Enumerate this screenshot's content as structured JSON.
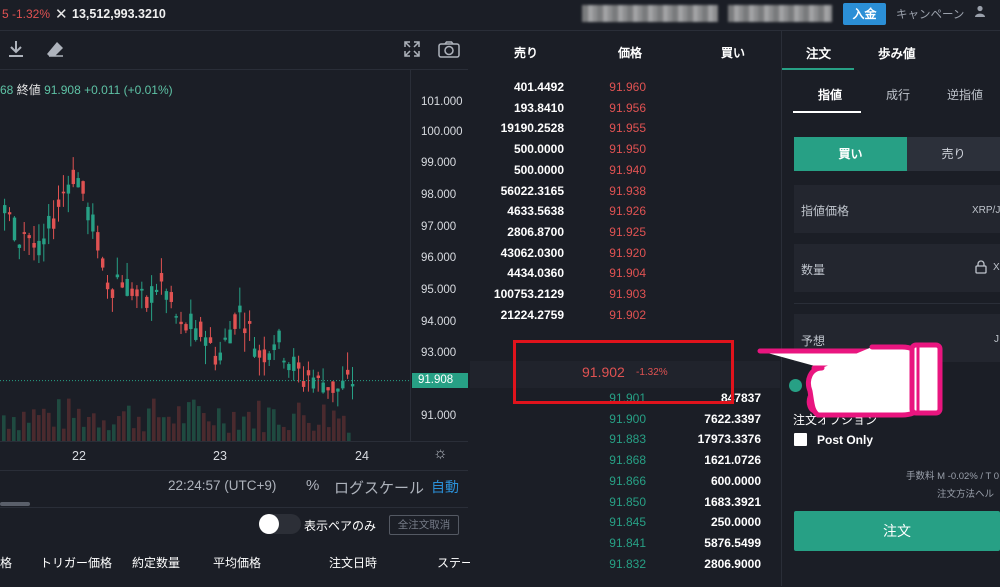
{
  "topbar": {
    "pair_change": "5 -1.32%",
    "volume_icon": "x-icon",
    "volume": "13,512,993.3210",
    "deposit": "入金",
    "campaign": "キャンペーン",
    "user_icon": "user-icon"
  },
  "chart": {
    "ohlc_prefix": "68",
    "ohlc_close_label": "終値",
    "ohlc_close": "91.908",
    "ohlc_diff": "+0.011 (+0.01%)",
    "price_ticks": [
      "101.000",
      "100.000",
      "99.000",
      "98.000",
      "97.000",
      "96.000",
      "95.000",
      "94.000",
      "93.000",
      "91.000"
    ],
    "current_price": "91.908",
    "date_ticks": [
      "22",
      "23",
      "24"
    ],
    "clock": "22:24:57 (UTC+9)",
    "percent": "%",
    "log_scale": "ログスケール",
    "auto": "自動",
    "up_color": "#27a085",
    "down_color": "#e05252"
  },
  "orders": {
    "toggle_label": "表示ペアのみ",
    "cancel_all": "全注文取消",
    "columns": [
      "価格",
      "トリガー価格",
      "約定数量",
      "平均価格",
      "注文日時",
      "ステー"
    ]
  },
  "orderbook": {
    "headers": {
      "sell": "売り",
      "price": "価格",
      "buy": "買い"
    },
    "asks": [
      {
        "qty": "401.4492",
        "price": "91.960"
      },
      {
        "qty": "193.8410",
        "price": "91.956"
      },
      {
        "qty": "19190.2528",
        "price": "91.955"
      },
      {
        "qty": "500.0000",
        "price": "91.950"
      },
      {
        "qty": "500.0000",
        "price": "91.940"
      },
      {
        "qty": "56022.3165",
        "price": "91.938"
      },
      {
        "qty": "4633.5638",
        "price": "91.926"
      },
      {
        "qty": "2806.8700",
        "price": "91.925"
      },
      {
        "qty": "43062.0300",
        "price": "91.920"
      },
      {
        "qty": "4434.0360",
        "price": "91.904"
      },
      {
        "qty": "100753.2129",
        "price": "91.903"
      },
      {
        "qty": "21224.2759",
        "price": "91.902"
      }
    ],
    "last_price": "91.902",
    "last_change": "-1.32%",
    "bids": [
      {
        "price": "91.901",
        "qty": "847837"
      },
      {
        "price": "91.900",
        "qty": "7622.3397"
      },
      {
        "price": "91.883",
        "qty": "17973.3376"
      },
      {
        "price": "91.868",
        "qty": "1621.0726"
      },
      {
        "price": "91.866",
        "qty": "600.0000"
      },
      {
        "price": "91.850",
        "qty": "1683.3921"
      },
      {
        "price": "91.845",
        "qty": "250.0000"
      },
      {
        "price": "91.841",
        "qty": "5876.5499"
      },
      {
        "price": "91.832",
        "qty": "2806.9000"
      }
    ]
  },
  "orderform": {
    "tab_order": "注文",
    "tab_trades": "歩み値",
    "type_limit": "指値",
    "type_market": "成行",
    "type_stop": "逆指値",
    "buy": "買い",
    "sell": "売り",
    "limit_price_label": "指値価格",
    "limit_price_unit": "XRP/J",
    "quantity_label": "数量",
    "quantity_unit": "X",
    "estimate_label": "予想",
    "estimate_unit": "J",
    "options_label": "注文オプション",
    "post_only": "Post Only",
    "fee": "手数料 M -0.02% / T 0",
    "how_to": "注文方法ヘル",
    "submit": "注文"
  }
}
